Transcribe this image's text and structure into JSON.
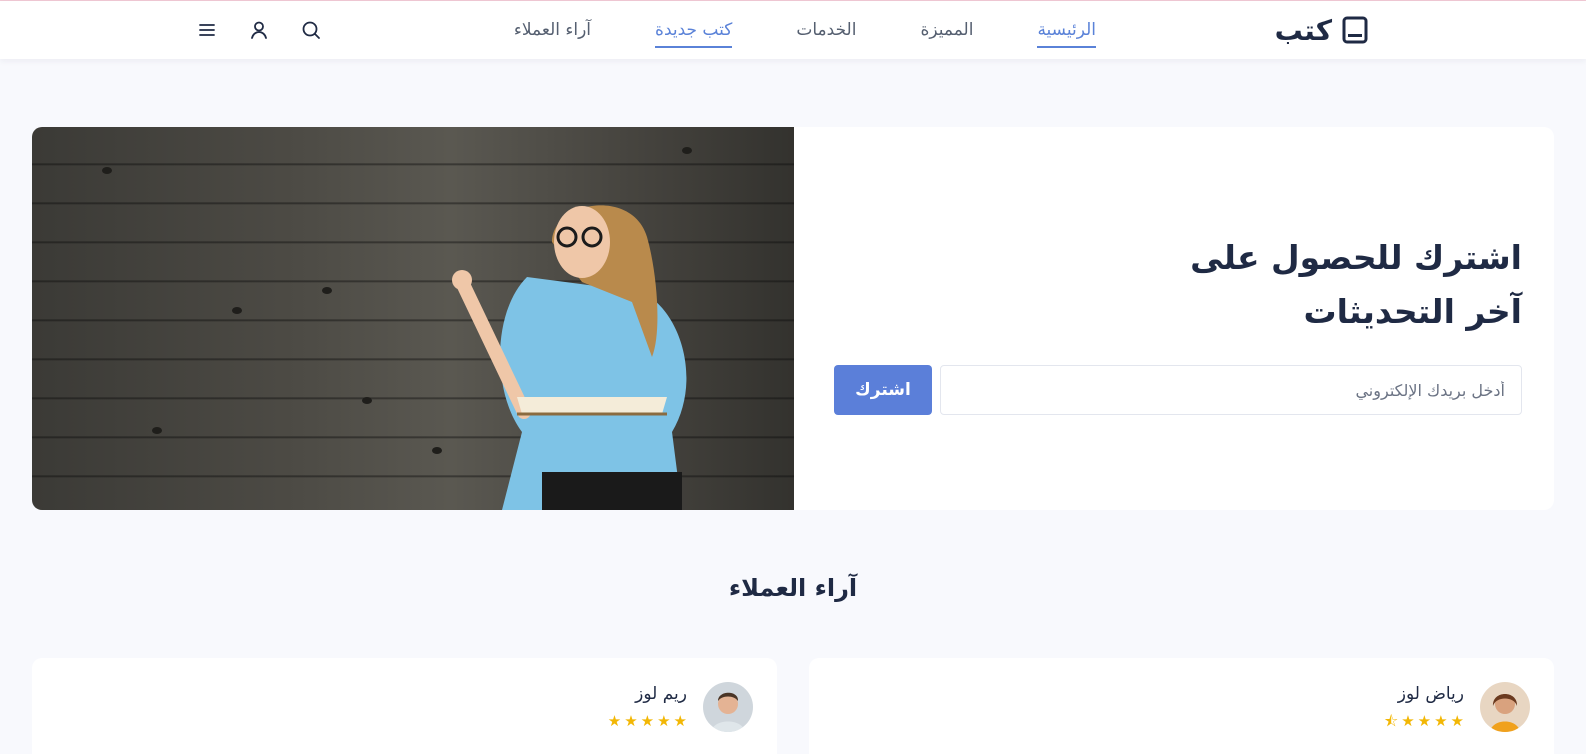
{
  "brand": {
    "name": "كتب",
    "icon": "book-icon"
  },
  "nav": {
    "items": [
      {
        "label": "الرئيسية",
        "active": true
      },
      {
        "label": "المميزة",
        "active": false
      },
      {
        "label": "الخدمات",
        "active": false
      },
      {
        "label": "كتب جديدة",
        "active": true
      },
      {
        "label": "آراء العملاء",
        "active": false
      }
    ]
  },
  "header_icons": [
    "search-icon",
    "user-icon",
    "menu-icon"
  ],
  "hero": {
    "title_line1": "اشترك للحصول على",
    "title_line2": "آخر التحديثات",
    "email_placeholder": "أدخل بريدك الإلكتروني",
    "subscribe_label": "اشترك"
  },
  "reviews_section": {
    "title": "آراء العملاء",
    "reviews": [
      {
        "name": "رياض لوز",
        "rating": 4.5
      },
      {
        "name": "ريم لوز",
        "rating": 5
      }
    ]
  },
  "colors": {
    "accent": "#5b7fd9",
    "star": "#f2b705",
    "text": "#1f2a44"
  }
}
